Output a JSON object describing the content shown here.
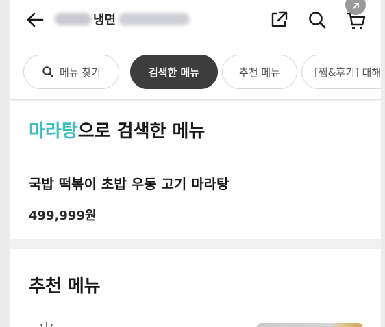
{
  "header": {
    "title": "냉면",
    "icons": [
      "back-arrow-icon",
      "share-icon",
      "search-icon",
      "cart-icon",
      "expand-icon"
    ]
  },
  "chips": [
    {
      "label": "메뉴 찾기",
      "icon": "search-icon",
      "active": false
    },
    {
      "label": "검색한 메뉴",
      "active": true
    },
    {
      "label": "추천 메뉴",
      "active": false
    },
    {
      "label": "[찜&후기] 대해",
      "active": false
    }
  ],
  "searched": {
    "keyword": "마라탕",
    "heading_suffix": "으로 검색한 메뉴",
    "menu_name": "국밥 떡볶이 초밥 우동 고기 마라탕",
    "price": "499,999원"
  },
  "recommended": {
    "heading": "추천 메뉴"
  },
  "colors": {
    "accent": "#3fbdbf",
    "active_chip": "#3d3d3d",
    "background": "#f1f1f1"
  }
}
